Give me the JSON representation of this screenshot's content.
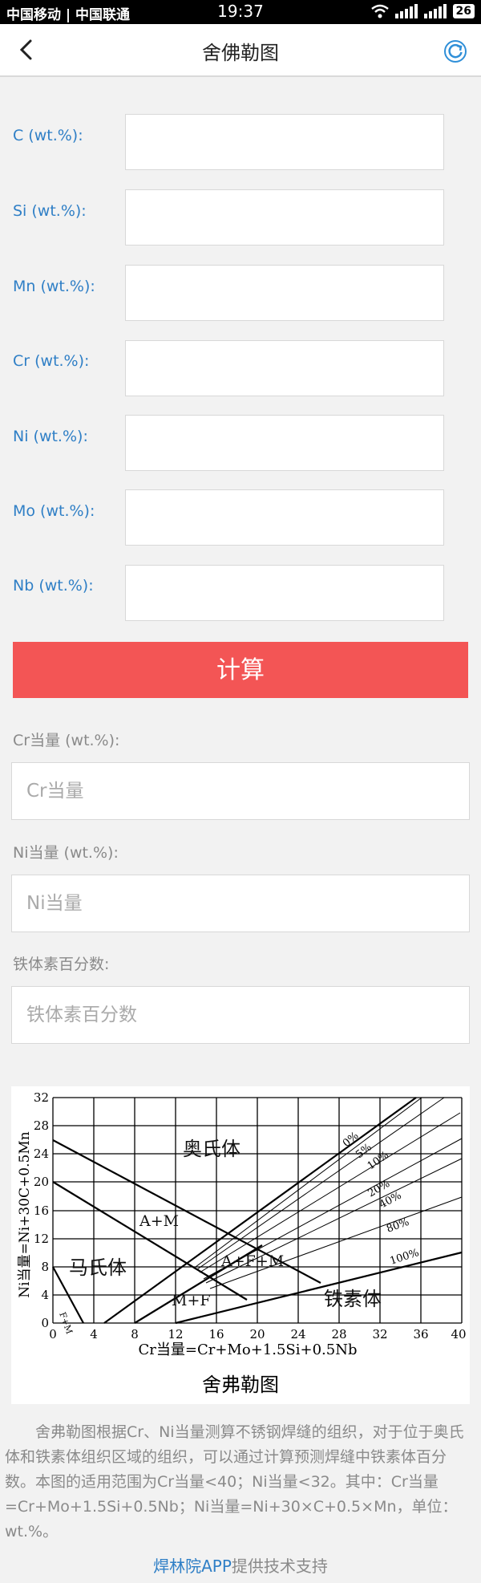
{
  "status": {
    "carriers": "中国移动 | 中国联通",
    "time": "19:37",
    "battery": "26"
  },
  "header": {
    "title": "舍佛勒图"
  },
  "inputs": [
    {
      "label": "C (wt.%):"
    },
    {
      "label": "Si (wt.%):"
    },
    {
      "label": "Mn (wt.%):"
    },
    {
      "label": "Cr (wt.%):"
    },
    {
      "label": "Ni (wt.%):"
    },
    {
      "label": "Mo (wt.%):"
    },
    {
      "label": "Nb (wt.%):"
    }
  ],
  "calc_label": "计算",
  "results": {
    "cr": {
      "label": "Cr当量 (wt.%):",
      "placeholder": "Cr当量"
    },
    "ni": {
      "label": "Ni当量 (wt.%):",
      "placeholder": "Ni当量"
    },
    "ferrite": {
      "label": "铁体素百分数:",
      "placeholder": "铁体素百分数"
    }
  },
  "diagram": {
    "x_ticks": [
      "0",
      "4",
      "8",
      "12",
      "16",
      "20",
      "24",
      "28",
      "32",
      "36",
      "40"
    ],
    "y_ticks": [
      "0",
      "4",
      "8",
      "12",
      "16",
      "20",
      "24",
      "28",
      "32"
    ],
    "x_label": "Cr当量=Cr+Mo+1.5Si+0.5Nb",
    "y_label": "Ni当量=Ni+30C+0.5Mn",
    "caption": "舍弗勒图",
    "regions": {
      "austenite": "奥氏体",
      "martensite": "马氏体",
      "ferrite": "铁素体",
      "am": "A+M",
      "afm": "A+F+M",
      "mf": "M+F",
      "fm": "F+M"
    },
    "ferrite_lines": [
      "0%",
      "5%",
      "10%",
      "20%",
      "40%",
      "80%",
      "100%"
    ]
  },
  "description": "舍弗勒图根据Cr、Ni当量测算不锈钢焊缝的组织，对于位于奥氏体和铁素体组织区域的组织，可以通过计算预测焊缝中铁素体百分数。本图的适用范围为Cr当量<40；Ni当量<32。其中：Cr当量=Cr+Mo+1.5Si+0.5Nb；Ni当量=Ni+30×C+0.5×Mn，单位：wt.%。",
  "footer": {
    "link": "焊林院APP",
    "text": "提供技术支持"
  }
}
